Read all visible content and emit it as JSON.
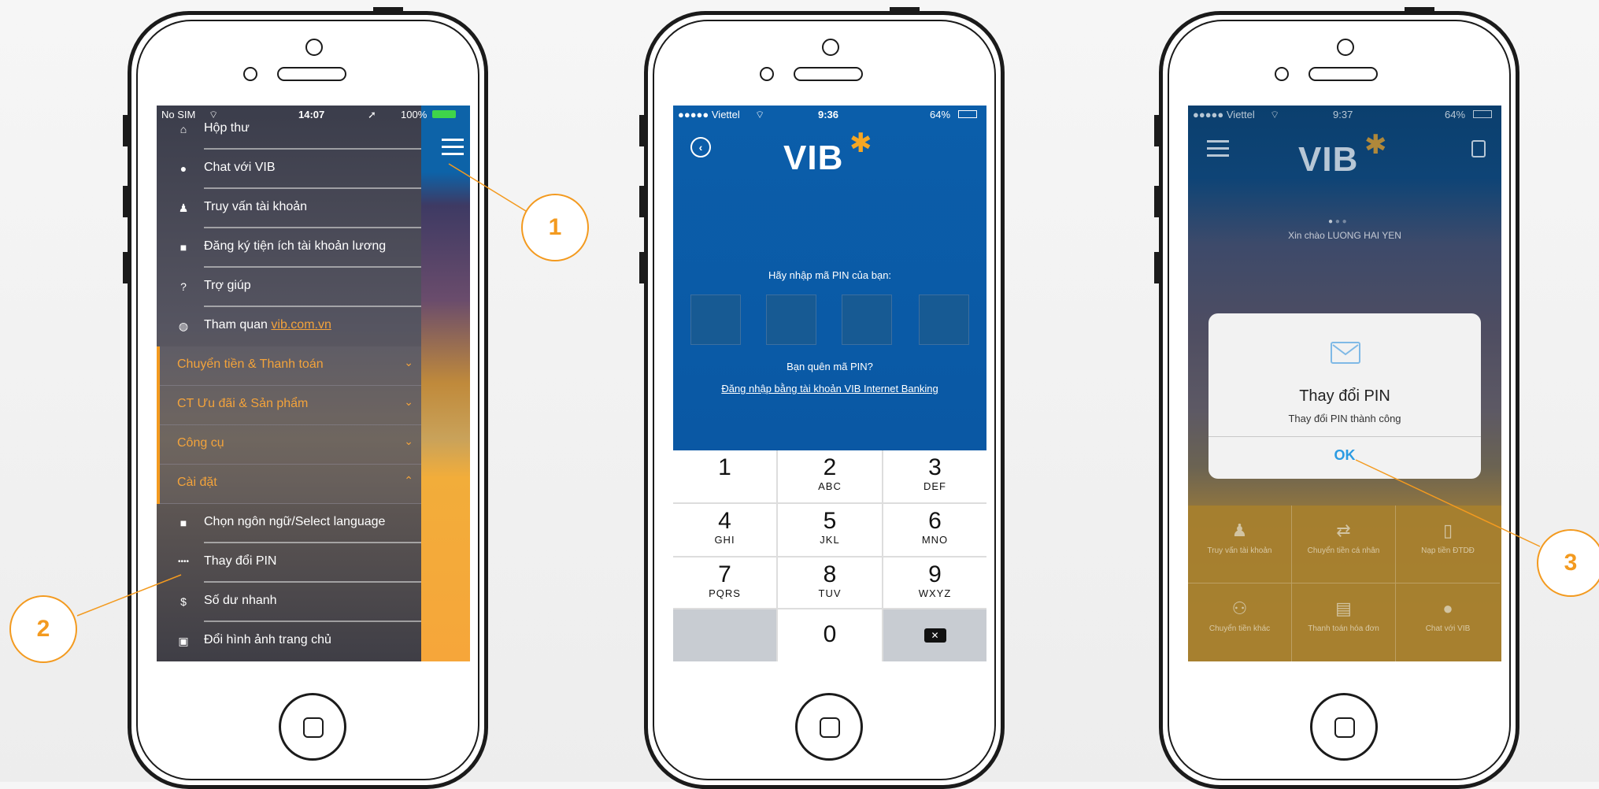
{
  "colors": {
    "accent": "#f39a1f",
    "vib_blue": "#0b5eaa",
    "link_blue": "#2a9be2"
  },
  "annotations": [
    "1",
    "2",
    "3"
  ],
  "screen1": {
    "status": {
      "carrier": "No SIM",
      "time": "14:07",
      "battery": "100%"
    },
    "menu_items_top": [
      {
        "label": "Hộp thư",
        "icon": "inbox-icon"
      },
      {
        "label": "Chat với VIB",
        "icon": "chat-icon"
      },
      {
        "label": "Truy vấn tài khoản",
        "icon": "user-icon"
      },
      {
        "label": "Đăng ký tiện ích tài khoản lương",
        "icon": "wallet-icon"
      },
      {
        "label": "Trợ giúp",
        "icon": "help-icon"
      },
      {
        "label_prefix": "Tham quan ",
        "link": "vib.com.vn",
        "icon": "globe-icon"
      }
    ],
    "sections": [
      {
        "label": "Chuyển tiền & Thanh toán"
      },
      {
        "label": "CT Ưu đãi & Sản phẩm"
      },
      {
        "label": "Công cụ"
      },
      {
        "label": "Cài đặt"
      }
    ],
    "settings_items": [
      {
        "label": "Chọn ngôn ngữ/Select language",
        "icon": "language-icon"
      },
      {
        "label": "Thay đổi PIN",
        "icon": "pin-dots-icon"
      },
      {
        "label": "Số dư nhanh",
        "icon": "dollar-icon"
      },
      {
        "label": "Đổi hình ảnh trang chủ",
        "icon": "image-icon"
      }
    ]
  },
  "screen2": {
    "status": {
      "carrier": "●●●●● Viettel",
      "time": "9:36",
      "battery": "64%"
    },
    "logo": "VIB",
    "prompt": "Hãy nhập mã PIN của bạn:",
    "forgot": "Bạn quên mã PIN?",
    "login_link": "Đăng nhập bằng tài khoản VIB Internet Banking",
    "keys": [
      {
        "num": "1",
        "sub": ""
      },
      {
        "num": "2",
        "sub": "ABC"
      },
      {
        "num": "3",
        "sub": "DEF"
      },
      {
        "num": "4",
        "sub": "GHI"
      },
      {
        "num": "5",
        "sub": "JKL"
      },
      {
        "num": "6",
        "sub": "MNO"
      },
      {
        "num": "7",
        "sub": "PQRS"
      },
      {
        "num": "8",
        "sub": "TUV"
      },
      {
        "num": "9",
        "sub": "WXYZ"
      },
      {
        "num": "0",
        "sub": ""
      }
    ]
  },
  "screen3": {
    "status": {
      "carrier": "●●●●● Viettel",
      "time": "9:37",
      "battery": "64%"
    },
    "logo": "VIB",
    "greeting": "Xin chào LUONG HAI YEN",
    "dialog": {
      "title": "Thay đổi PIN",
      "message": "Thay đổi PIN thành công",
      "ok": "OK"
    },
    "grid": [
      {
        "label": "Truy vấn tài khoản",
        "icon": "user-icon"
      },
      {
        "label": "Chuyển tiền cá nhân",
        "icon": "transfer-icon"
      },
      {
        "label": "Nạp tiền ĐTDĐ",
        "icon": "mobile-icon"
      },
      {
        "label": "Chuyển tiền khác",
        "icon": "transfer-other-icon"
      },
      {
        "label": "Thanh toán hóa đơn",
        "icon": "bill-icon"
      },
      {
        "label": "Chat với VIB",
        "icon": "chat-icon"
      }
    ]
  }
}
